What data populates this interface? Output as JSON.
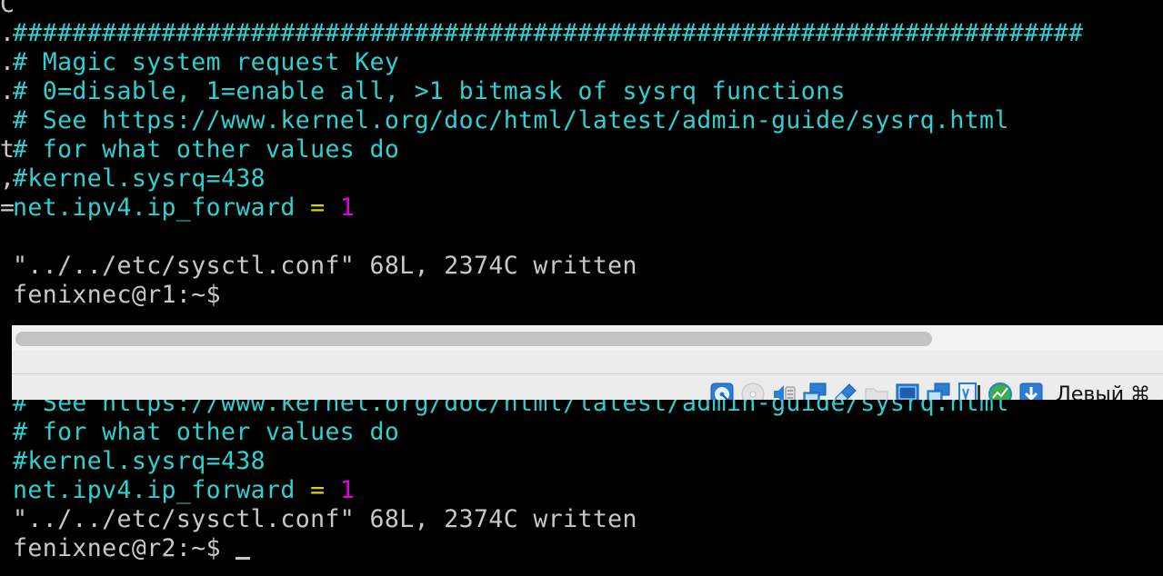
{
  "terminal_top": {
    "stray_top": "C",
    "lines": [
      {
        "gutter": ".",
        "kind": "comment",
        "text": "########################################################################"
      },
      {
        "gutter": ".",
        "kind": "comment",
        "text": "# Magic system request Key"
      },
      {
        "gutter": ".",
        "kind": "comment",
        "text": "# 0=disable, 1=enable all, >1 bitmask of sysrq functions"
      },
      {
        "gutter": "",
        "kind": "comment",
        "text": "# See https://www.kernel.org/doc/html/latest/admin-guide/sysrq.html"
      },
      {
        "gutter": "t",
        "kind": "comment",
        "text": "# for what other values do"
      },
      {
        "gutter": ",",
        "kind": "comment",
        "text": "#kernel.sysrq=438"
      },
      {
        "gutter": "=",
        "kind": "setting",
        "key": "net.ipv4.ip_forward",
        "op": " = ",
        "value": "1"
      },
      {
        "gutter": "",
        "kind": "blank",
        "text": ""
      },
      {
        "gutter": "",
        "kind": "output",
        "text": "\"../../etc/sysctl.conf\" 68L, 2374C written"
      },
      {
        "gutter": "",
        "kind": "output",
        "text": "fenixnec@r1:~$"
      }
    ]
  },
  "terminal_bottom": {
    "lines": [
      {
        "kind": "comment",
        "text": "# See https://www.kernel.org/doc/html/latest/admin-guide/sysrq.html"
      },
      {
        "kind": "comment",
        "text": "# for what other values do"
      },
      {
        "kind": "comment",
        "text": "#kernel.sysrq=438"
      },
      {
        "kind": "setting",
        "key": "net.ipv4.ip_forward",
        "op": " = ",
        "value": "1"
      },
      {
        "kind": "output",
        "text": "\"../../etc/sysctl.conf\" 68L, 2374C written"
      },
      {
        "kind": "output",
        "text": "fenixnec@r2:~$ "
      }
    ]
  },
  "statusbar": {
    "icons": [
      "hard-disk-icon",
      "optical-drive-icon",
      "audio-icon",
      "network-icon",
      "usb-icon",
      "shared-folder-icon",
      "display-icon",
      "dual-display-icon",
      "video-capture-icon",
      "cpu-activity-icon",
      "mouse-integration-icon"
    ],
    "host_key": "Левый ⌘"
  },
  "colors": {
    "comment": "#2fd0d0",
    "text": "#c8c8c8",
    "operator": "#d8d800",
    "number": "#e000e0",
    "background": "#000000"
  }
}
